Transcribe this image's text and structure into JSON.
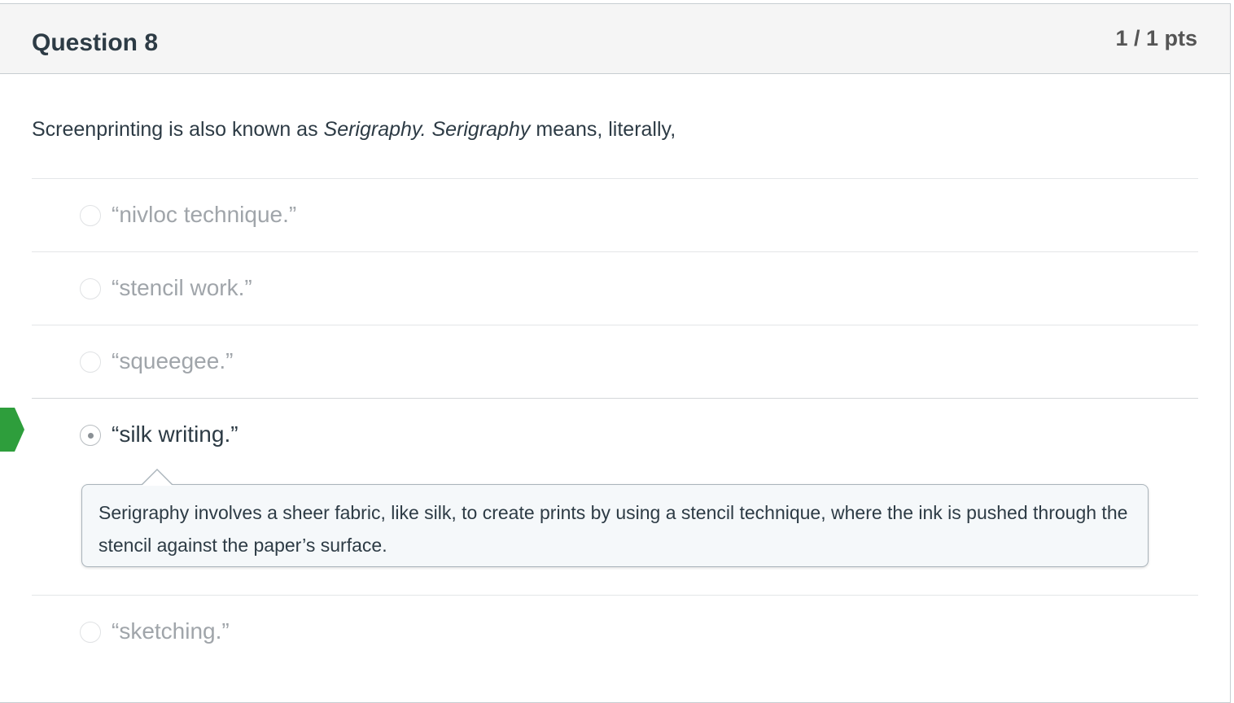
{
  "question": {
    "title": "Question 8",
    "points": "1 / 1 pts",
    "text_prefix": "Screenprinting is also known as ",
    "text_italic_1": "Serigraphy. Serigraphy",
    "text_suffix": " means, literally,"
  },
  "answers": [
    {
      "label": "“nivloc technique.”",
      "selected": false
    },
    {
      "label": "“stencil work.”",
      "selected": false
    },
    {
      "label": "“squeegee.”",
      "selected": false
    },
    {
      "label": "“silk writing.”",
      "selected": true,
      "correct": true
    },
    {
      "label": "“sketching.”",
      "selected": false
    }
  ],
  "feedback": {
    "text": "Serigraphy involves a sheer fabric, like silk, to create prints by using a stencil technique, where the ink is pushed through the stencil against the paper’s surface."
  },
  "colors": {
    "correct_marker": "#2e9e3c",
    "header_bg": "#f5f5f5",
    "text": "#2d3b45",
    "muted_text": "#a0a5aa"
  },
  "icons": {
    "correct_marker": "correct-answer-flag-icon",
    "radio": "radio-button-icon"
  }
}
